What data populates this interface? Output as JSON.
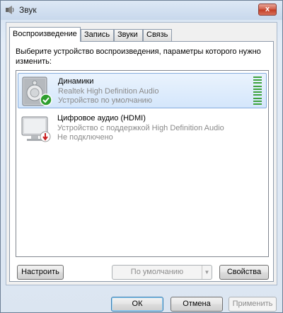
{
  "window": {
    "title": "Звук",
    "close_label": "x"
  },
  "tabs": [
    {
      "label": "Воспроизведение",
      "active": true
    },
    {
      "label": "Запись",
      "active": false
    },
    {
      "label": "Звуки",
      "active": false
    },
    {
      "label": "Связь",
      "active": false
    }
  ],
  "instruction": "Выберите устройство воспроизведения, параметры которого нужно изменить:",
  "devices": [
    {
      "name": "Динамики",
      "line1": "Realtek High Definition Audio",
      "line2": "Устройство по умолчанию",
      "icon": "speaker-icon",
      "status_icon": "check-icon",
      "selected": true
    },
    {
      "name": "Цифровое аудио (HDMI)",
      "line1": "Устройство с поддержкой High Definition Audio",
      "line2": "Не подключено",
      "icon": "monitor-icon",
      "status_icon": "disconnected-icon",
      "selected": false
    }
  ],
  "buttons": {
    "configure": "Настроить",
    "set_default": "По умолчанию",
    "properties": "Свойства",
    "ok": "ОК",
    "cancel": "Отмена",
    "apply": "Применить"
  },
  "colors": {
    "level_meter": "#3da33d",
    "selection": "#d4e6fb",
    "check": "#2e9e2e",
    "disconnected": "#c81e1e"
  }
}
